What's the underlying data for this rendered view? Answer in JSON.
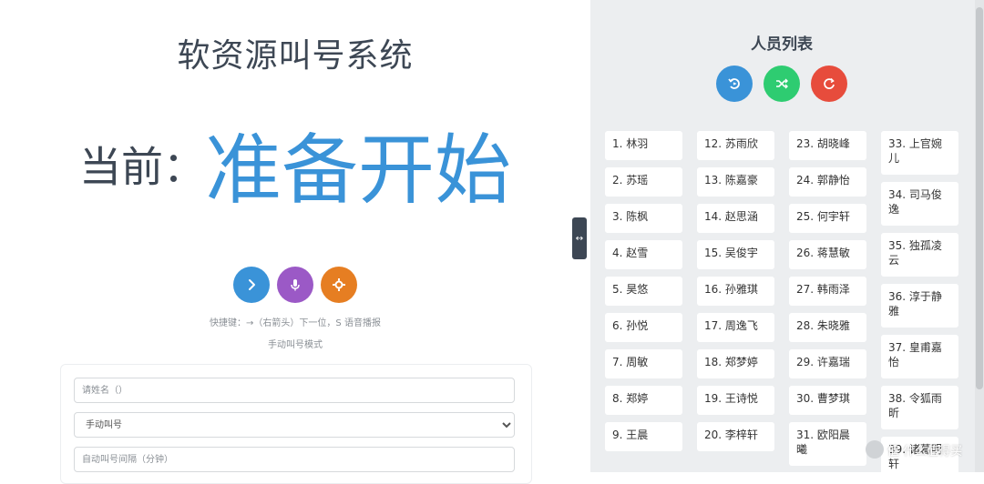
{
  "app_title": "软资源叫号系统",
  "current": {
    "prefix": "当前：",
    "value": "准备开始"
  },
  "controls": [
    {
      "name": "next-button",
      "icon": "chevron-right-icon",
      "color": "#3a93d8"
    },
    {
      "name": "voice-button",
      "icon": "microphone-icon",
      "color": "#9b59c6"
    },
    {
      "name": "settings-button",
      "icon": "gear-icon",
      "color": "#e67e22"
    }
  ],
  "hint": "快捷键：→（右箭头）下一位，S 语音播报",
  "mode_text": "手动叫号模式",
  "form": {
    "name_placeholder": "请姓名（）",
    "mode_selected": "手动叫号",
    "interval_placeholder": "自动叫号间隔（分钟）"
  },
  "panel": {
    "title": "人员列表",
    "controls": [
      {
        "name": "reset-list-button",
        "icon": "reset-icon",
        "color": "#3a93d8"
      },
      {
        "name": "shuffle-button",
        "icon": "shuffle-icon",
        "color": "#2ecc71"
      },
      {
        "name": "refresh-button",
        "icon": "refresh-icon",
        "color": "#e74c3c"
      }
    ]
  },
  "people": {
    "col1": [
      "1. 林羽",
      "2. 苏瑶",
      "3. 陈枫",
      "4. 赵雪",
      "5. 昊悠",
      "6. 孙悦",
      "7. 周敏",
      "8. 郑婷",
      "9. 王晨"
    ],
    "col2": [
      "12. 苏雨欣",
      "13. 陈嘉豪",
      "14. 赵思涵",
      "15. 吴俊宇",
      "16. 孙雅琪",
      "17. 周逸飞",
      "18. 郑梦婷",
      "19. 王诗悦",
      "20. 李梓轩"
    ],
    "col3": [
      "23. 胡晓峰",
      "24. 郭静怡",
      "25. 何宇轩",
      "26. 蒋慧敏",
      "27. 韩雨泽",
      "28. 朱晓雅",
      "29. 许嘉瑞",
      "30. 曹梦琪",
      "31. 欧阳晨曦"
    ],
    "col4": [
      "33. 上官婉儿",
      "34. 司马俊逸",
      "35. 独孤凌云",
      "36. 淳于静雅",
      "37. 皇甫嘉怡",
      "38. 令狐雨昕",
      "39. 诸葛明轩"
    ]
  },
  "watermark": "值 什么值得买"
}
